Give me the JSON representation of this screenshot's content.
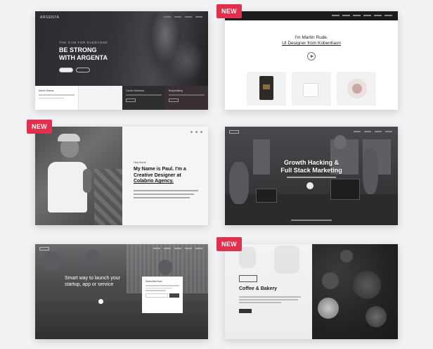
{
  "badges": {
    "new_label": "NEW"
  },
  "colors": {
    "badge": "#e0304e",
    "background": "#f2f2f4"
  },
  "cards": [
    {
      "id": "argenta",
      "logo": "ARGENTA",
      "kicker": "THE GYM FOR EVERYONE",
      "headline_1": "BE STRONG",
      "headline_2": "WITH ARGENTA",
      "strip_titles": [
        "Men's Fitness",
        "Cardio Workouts",
        "Bodybuilding"
      ]
    },
    {
      "id": "martin-rude",
      "intro_1": "I'm Martin Rude.",
      "intro_2": "UI Designer from Kobenhavn"
    },
    {
      "id": "paul",
      "greeting": "Hey there!",
      "title_1": "My Name is Paul. I'm a",
      "title_2": "Creative Designer at",
      "title_3": "Colabrio Agency."
    },
    {
      "id": "growth",
      "headline_1": "Growth Hacking &",
      "headline_2": "Full Stack Marketing"
    },
    {
      "id": "startup",
      "headline_1": "Smart way to launch your",
      "headline_2": "startup, app or service",
      "form_title": "Subscribe Now"
    },
    {
      "id": "coffee",
      "title": "Coffee & Bakery"
    }
  ]
}
